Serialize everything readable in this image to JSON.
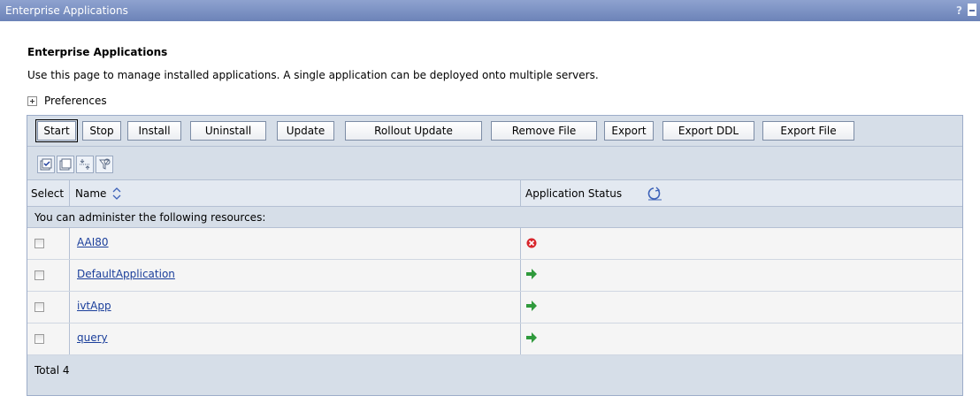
{
  "window": {
    "title": "Enterprise Applications",
    "help_label": "?"
  },
  "page": {
    "heading": "Enterprise Applications",
    "description": "Use this page to manage installed applications. A single application can be deployed onto multiple servers.",
    "preferences_label": "Preferences"
  },
  "toolbar": {
    "buttons": [
      "Start",
      "Stop",
      "Install",
      "Uninstall",
      "Update",
      "Rollout Update",
      "Remove File",
      "Export",
      "Export DDL",
      "Export File"
    ],
    "icon_buttons": [
      "select-all-icon",
      "deselect-all-icon",
      "expand-collapse-icon",
      "filter-icon"
    ]
  },
  "table": {
    "columns": [
      "Select",
      "Name",
      "Application Status"
    ],
    "info_text": "You can administer the following resources:",
    "rows": [
      {
        "name": "AAI80",
        "status": "stopped",
        "status_icon": "stopped-icon"
      },
      {
        "name": "DefaultApplication",
        "status": "started",
        "status_icon": "started-icon"
      },
      {
        "name": "ivtApp",
        "status": "started",
        "status_icon": "started-icon"
      },
      {
        "name": "query",
        "status": "started",
        "status_icon": "started-icon"
      }
    ],
    "total": "Total 4"
  },
  "colors": {
    "titlebar": "#7890c4",
    "panel_bg": "#d6dee8",
    "link": "#1b3f9b",
    "stopped": "#d8262c",
    "started": "#2f9a3c"
  }
}
